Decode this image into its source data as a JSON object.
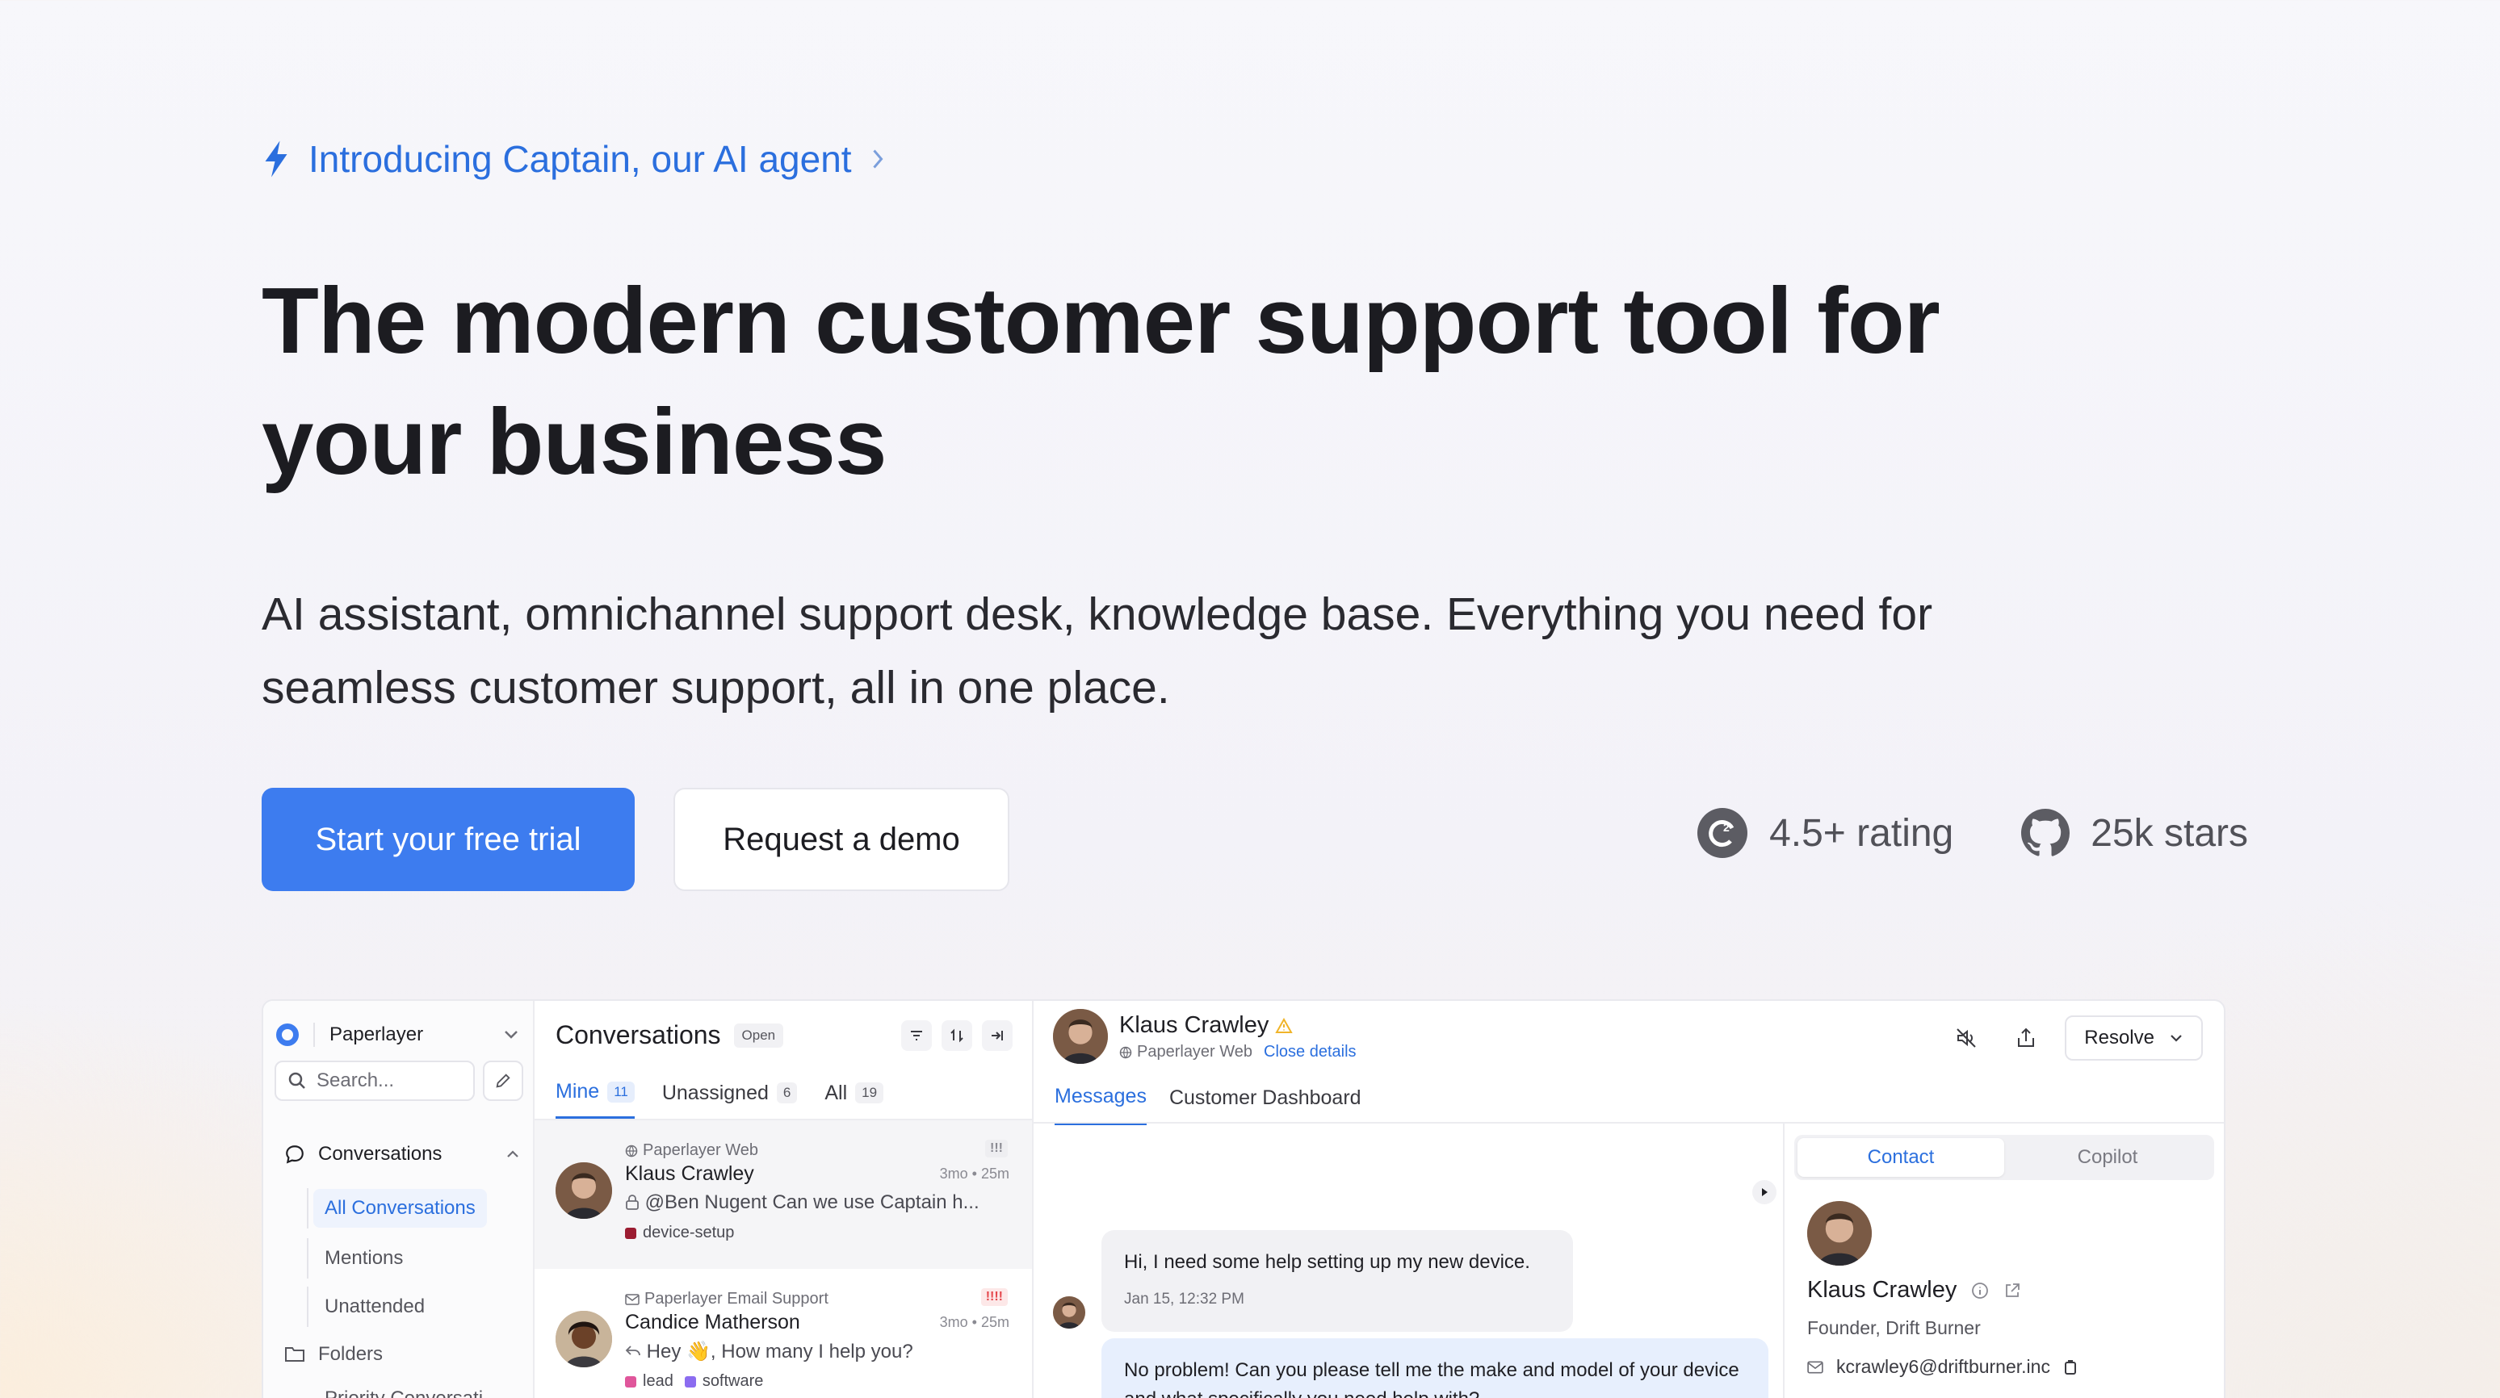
{
  "announcement": {
    "text": "Introducing Captain, our AI agent"
  },
  "hero": {
    "headline": "The modern customer support tool for your business",
    "subline": "AI assistant, omnichannel support desk, knowledge base. Everything you need for seamless customer support, all in one place.",
    "primary_cta": "Start your free trial",
    "secondary_cta": "Request a demo",
    "rating": "4.5+ rating",
    "stars": "25k stars"
  },
  "colors": {
    "accent": "#3d7cef",
    "link": "#2b6fde",
    "text": "#1c1c21"
  },
  "app": {
    "sidebar": {
      "workspace": "Paperlayer",
      "search_placeholder": "Search...",
      "conversations_label": "Conversations",
      "items": [
        "All Conversations",
        "Mentions",
        "Unattended"
      ],
      "folders_label": "Folders",
      "folder_item": "Priority Conversati"
    },
    "conversations": {
      "title": "Conversations",
      "status": "Open",
      "tabs": [
        {
          "label": "Mine",
          "count": "11"
        },
        {
          "label": "Unassigned",
          "count": "6"
        },
        {
          "label": "All",
          "count": "19"
        }
      ],
      "list": [
        {
          "source": "Paperlayer Web",
          "name": "Klaus Crawley",
          "time": "3mo • 25m",
          "message": "@Ben Nugent Can we use Captain h...",
          "tags": [
            {
              "label": "device-setup",
              "color": "#9b1c31"
            }
          ],
          "priority": "!!!",
          "priority_color": "#8a8a92"
        },
        {
          "source": "Paperlayer Email Support",
          "name": "Candice Matherson",
          "time": "3mo • 25m",
          "message": "Hey 👋, How many I help you?",
          "tags": [
            {
              "label": "lead",
              "color": "#e0569b"
            },
            {
              "label": "software",
              "color": "#8b6cf0"
            }
          ],
          "priority": "!!!!",
          "priority_color": "#e5484d"
        }
      ]
    },
    "chat": {
      "contact_name": "Klaus Crawley",
      "source": "Paperlayer Web",
      "close_details": "Close details",
      "resolve": "Resolve",
      "tabs": [
        "Messages",
        "Customer Dashboard"
      ],
      "messages": [
        {
          "text": "Hi, I need some help setting up my new device.",
          "time": "Jan 15, 12:32 PM"
        },
        {
          "text": "No problem! Can you please tell me the make and model of your device and what specifically you need help with?"
        }
      ]
    },
    "contact_panel": {
      "tabs": [
        "Contact",
        "Copilot"
      ],
      "name": "Klaus Crawley",
      "role": "Founder, Drift Burner",
      "email": "kcrawley6@driftburner.inc"
    }
  }
}
